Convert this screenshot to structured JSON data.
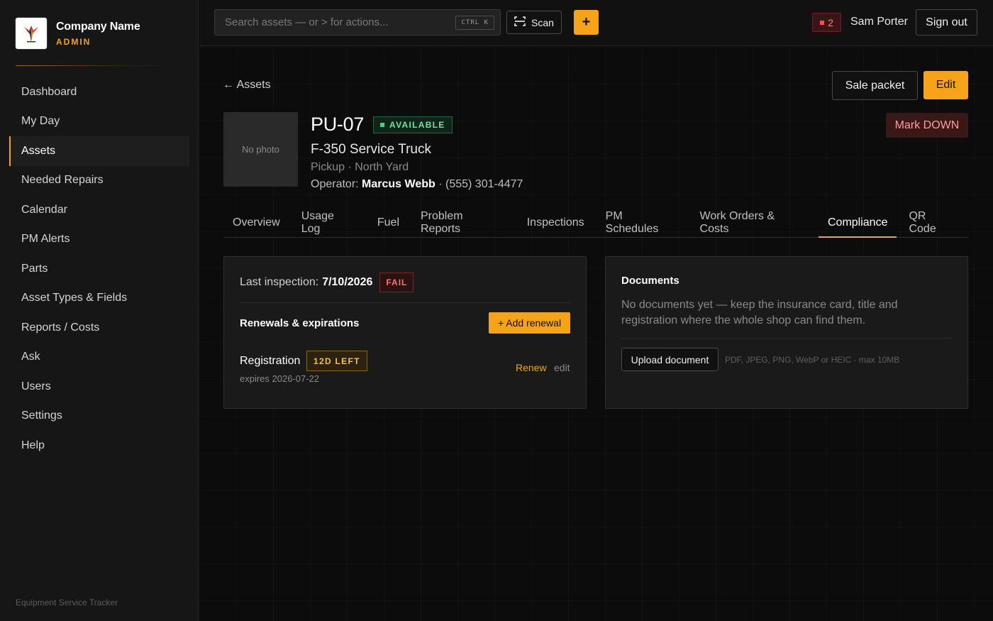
{
  "brand": {
    "name": "Company Name",
    "role": "ADMIN",
    "footer": "Equipment Service Tracker"
  },
  "sidebar": {
    "items": [
      {
        "label": "Dashboard"
      },
      {
        "label": "My Day"
      },
      {
        "label": "Assets",
        "active": true
      },
      {
        "label": "Needed Repairs"
      },
      {
        "label": "Calendar"
      },
      {
        "label": "PM Alerts"
      },
      {
        "label": "Parts"
      },
      {
        "label": "Asset Types & Fields"
      },
      {
        "label": "Reports / Costs"
      },
      {
        "label": "Ask"
      },
      {
        "label": "Users"
      },
      {
        "label": "Settings"
      },
      {
        "label": "Help"
      }
    ]
  },
  "topbar": {
    "search_placeholder": "Search assets — or > for actions...",
    "shortcut": "CTRL K",
    "scan_label": "Scan",
    "add_label": "+",
    "alert_count": "2",
    "user_name": "Sam Porter",
    "signout_label": "Sign out"
  },
  "page": {
    "back_label": "← Assets",
    "sale_packet_label": "Sale packet",
    "edit_label": "Edit",
    "mark_down_label": "Mark DOWN",
    "photo_placeholder": "No photo"
  },
  "asset": {
    "id": "PU-07",
    "status": "AVAILABLE",
    "name": "F-350 Service Truck",
    "meta": "Pickup · North Yard",
    "operator_label": "Operator:",
    "operator_name": "Marcus Webb",
    "operator_phone": "· (555) 301-4477"
  },
  "tabs": [
    {
      "label": "Overview"
    },
    {
      "label": "Usage Log"
    },
    {
      "label": "Fuel"
    },
    {
      "label": "Problem Reports"
    },
    {
      "label": "Inspections"
    },
    {
      "label": "PM Schedules"
    },
    {
      "label": "Work Orders & Costs"
    },
    {
      "label": "Compliance",
      "active": true
    },
    {
      "label": "QR Code"
    }
  ],
  "compliance": {
    "inspection_label": "Last inspection:",
    "inspection_date": "7/10/2026",
    "inspection_result": "FAIL",
    "renewals_title": "Renewals & expirations",
    "add_renewal_label": "+ Add renewal",
    "renewal": {
      "name": "Registration",
      "days_left": "12D LEFT",
      "expires": "expires 2026-07-22",
      "renew_label": "Renew",
      "edit_label": "edit"
    }
  },
  "documents": {
    "title": "Documents",
    "empty_text": "No documents yet — keep the insurance card, title and registration where the whole shop can find them.",
    "upload_label": "Upload document",
    "upload_hint": "PDF, JPEG, PNG, WebP or HEIC · max 10MB"
  },
  "colors": {
    "accent": "#f5a31a",
    "background": "#0c0c0c",
    "sidebar": "#161616",
    "success": "#6ee49a",
    "danger": "#ff7070",
    "warning": "#f5c242"
  },
  "icons": {
    "logo": "eagle-logo-icon",
    "scan": "scan-icon",
    "alert": "alert-square-icon"
  }
}
